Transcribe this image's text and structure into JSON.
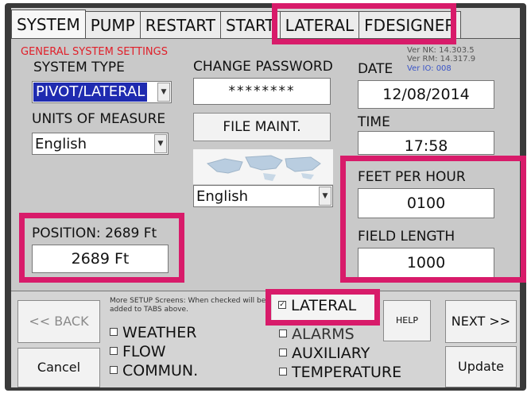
{
  "tabs": [
    {
      "label": "SYSTEM"
    },
    {
      "label": "PUMP"
    },
    {
      "label": "RESTART"
    },
    {
      "label": "START"
    },
    {
      "label": "LATERAL"
    },
    {
      "label": "FDESIGNER"
    }
  ],
  "general": {
    "header": "GENERAL SYSTEM SETTINGS",
    "system_type_label": "SYSTEM TYPE",
    "system_type_value": "PIVOT/LATERAL",
    "units_label": "UNITS OF MEASURE",
    "units_value": "English"
  },
  "password": {
    "label": "CHANGE PASSWORD",
    "value": "********"
  },
  "file_maint_label": "FILE MAINT.",
  "language_value": "English",
  "versions": {
    "nk": "Ver NK: 14.303.5",
    "rm": "Ver RM: 14.317.9",
    "io": "Ver IO: 008"
  },
  "date": {
    "label": "DATE",
    "value": "12/08/2014"
  },
  "time": {
    "label": "TIME",
    "value": "17:58"
  },
  "feet_per_hour": {
    "label": "FEET PER HOUR",
    "value": "0100"
  },
  "field_length": {
    "label": "FIELD LENGTH",
    "value": "1000"
  },
  "position": {
    "label": "POSITION: 2689 Ft",
    "value": "2689 Ft"
  },
  "nav": {
    "back_label": "<< BACK",
    "cancel_label": "Cancel",
    "help_label": "HELP",
    "next_label": "NEXT >>",
    "update_label": "Update"
  },
  "setup_note": "More SETUP Screens: When checked will be added to TABS above.",
  "checkboxes_left": [
    {
      "label": "WEATHER",
      "checked": false
    },
    {
      "label": "FLOW",
      "checked": false
    },
    {
      "label": "COMMUN.",
      "checked": false
    }
  ],
  "checkboxes_right": [
    {
      "label": "LATERAL",
      "checked": true
    },
    {
      "label": "ALARMS",
      "checked": false
    },
    {
      "label": "AUXILIARY",
      "checked": false
    },
    {
      "label": "TEMPERATURE",
      "checked": false
    }
  ],
  "colors": {
    "highlight": "#d81b6a",
    "header_red": "#e0202a",
    "version_blue": "#3a55c8",
    "selection_blue": "#1f2bb0"
  }
}
